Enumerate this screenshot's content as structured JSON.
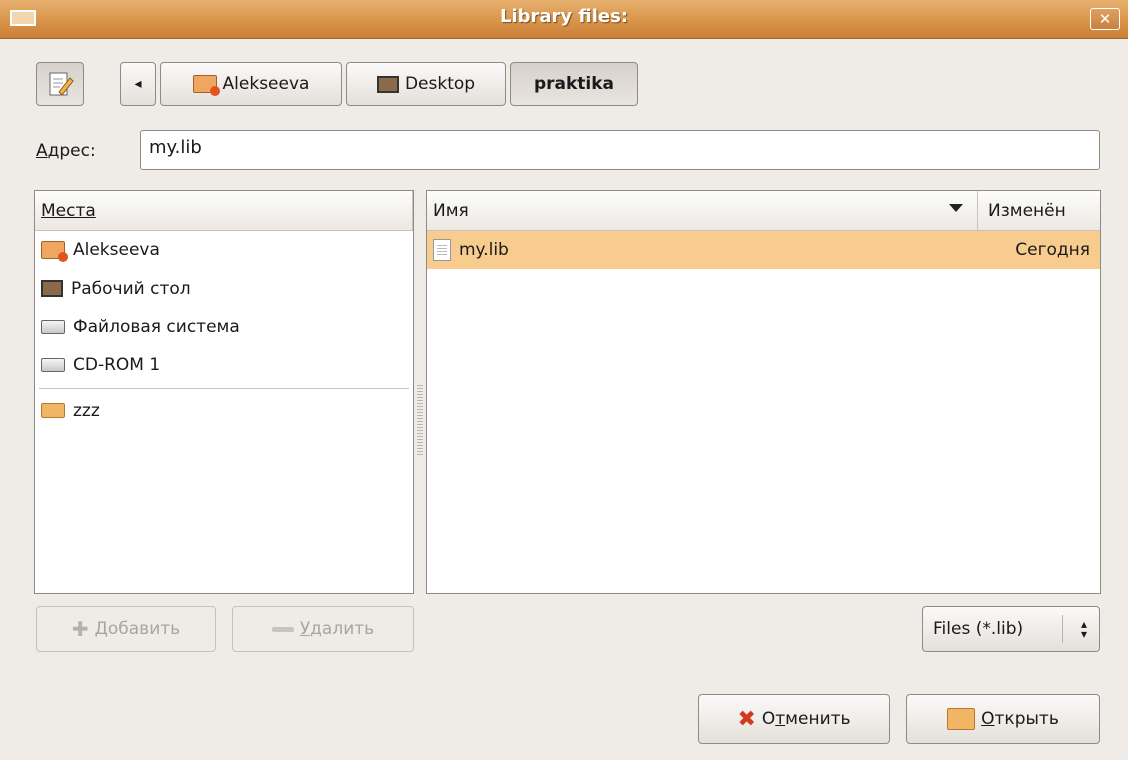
{
  "window": {
    "title": "Library files:",
    "close_label": "✕"
  },
  "toolbar": {
    "path": [
      "Alekseeva",
      "Desktop",
      "praktika"
    ],
    "back_label": "◂"
  },
  "location": {
    "label_first": "А",
    "label_rest": "дрес:",
    "value": "my.lib"
  },
  "places": {
    "header": "Места",
    "items": [
      {
        "label": "Alekseeva",
        "icon": "home-folder-icon"
      },
      {
        "label": "Рабочий стол",
        "icon": "desktop-icon"
      },
      {
        "label": "Файловая система",
        "icon": "drive-icon"
      },
      {
        "label": "CD-ROM 1",
        "icon": "cdrom-icon"
      }
    ],
    "bookmarks": [
      {
        "label": "zzz",
        "icon": "folder-icon"
      }
    ]
  },
  "files": {
    "col_name": "Имя",
    "col_modified": "Изменён",
    "rows": [
      {
        "name": "my.lib",
        "modified": "Сегодня",
        "selected": true
      }
    ]
  },
  "buttons": {
    "add_first": "Д",
    "add_rest": "обавить",
    "remove_first": "У",
    "remove_rest": "далить",
    "cancel_pre": "О",
    "cancel_ul": "т",
    "cancel_rest": "менить",
    "open_first": "О",
    "open_rest": "ткрыть"
  },
  "filter": {
    "selected": "Files (*.lib)"
  },
  "colors": {
    "titlebar": "#d9954a",
    "selection": "#f8cc8e"
  }
}
